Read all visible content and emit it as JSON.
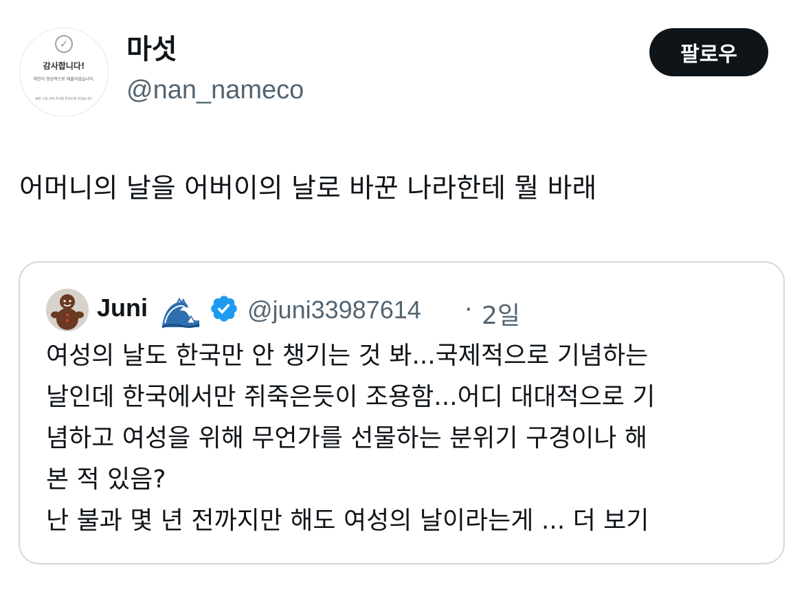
{
  "author": {
    "display_name": "마섯",
    "handle": "@nan_nameco",
    "avatar": {
      "line1": "감사합니다!",
      "line2": "피인이 정상적으로 제출되었습니다.",
      "line3": "빠른 시일 안에 조치를 취하도록 하겠습니다."
    }
  },
  "follow_button": {
    "label": "팔로우"
  },
  "tweet": {
    "text": "어머니의 날을 어버이의 날로 바꾼 나라한테 뭘 바래"
  },
  "quoted_tweet": {
    "author_name": "Juni",
    "name_emoji": "wave-emoji",
    "verified": true,
    "handle": "@juni33987614",
    "separator": "·",
    "time": "2일",
    "lines": [
      "여성의 날도 한국만 안 챙기는 것 봐...국제적으로 기념하는",
      "날인데 한국에서만 쥐죽은듯이 조용함...어디 대대적으로 기",
      "념하고 여성을 위해 무언가를 선물하는 분위기 구경이나 해",
      "본 적 있음?",
      "난 불과 몇 년 전까지만 해도 여성의 날이라는게 ... "
    ],
    "show_more": "더 보기"
  },
  "colors": {
    "text": "#0f1419",
    "secondary": "#536471",
    "border": "#cfd9de",
    "verified": "#1d9bf0",
    "button_bg": "#0f1419"
  }
}
